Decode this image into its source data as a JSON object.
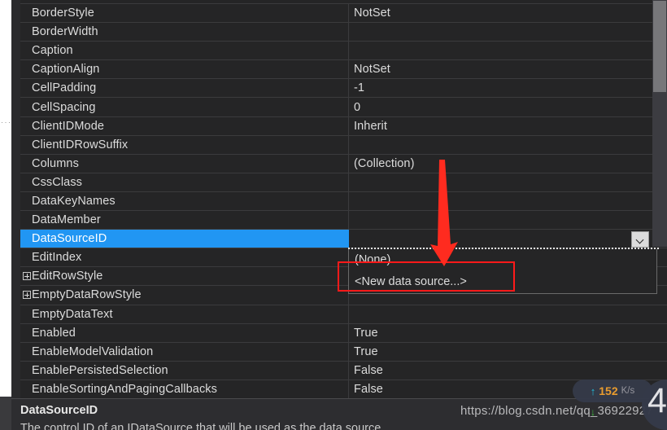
{
  "grid": {
    "rows": [
      {
        "name": "BorderStyle",
        "value": "NotSet",
        "expandable": false,
        "selected": false
      },
      {
        "name": "BorderWidth",
        "value": "",
        "expandable": false,
        "selected": false
      },
      {
        "name": "Caption",
        "value": "",
        "expandable": false,
        "selected": false
      },
      {
        "name": "CaptionAlign",
        "value": "NotSet",
        "expandable": false,
        "selected": false
      },
      {
        "name": "CellPadding",
        "value": "-1",
        "expandable": false,
        "selected": false
      },
      {
        "name": "CellSpacing",
        "value": "0",
        "expandable": false,
        "selected": false
      },
      {
        "name": "ClientIDMode",
        "value": "Inherit",
        "expandable": false,
        "selected": false
      },
      {
        "name": "ClientIDRowSuffix",
        "value": "",
        "expandable": false,
        "selected": false
      },
      {
        "name": "Columns",
        "value": "(Collection)",
        "expandable": false,
        "selected": false
      },
      {
        "name": "CssClass",
        "value": "",
        "expandable": false,
        "selected": false
      },
      {
        "name": "DataKeyNames",
        "value": "",
        "expandable": false,
        "selected": false
      },
      {
        "name": "DataMember",
        "value": "",
        "expandable": false,
        "selected": false
      },
      {
        "name": "DataSourceID",
        "value": "",
        "expandable": false,
        "selected": true
      },
      {
        "name": "EditIndex",
        "value": "(None)",
        "expandable": false,
        "selected": false
      },
      {
        "name": "EditRowStyle",
        "value": "",
        "expandable": true,
        "selected": false
      },
      {
        "name": "EmptyDataRowStyle",
        "value": "",
        "expandable": true,
        "selected": false
      },
      {
        "name": "EmptyDataText",
        "value": "",
        "expandable": false,
        "selected": false
      },
      {
        "name": "Enabled",
        "value": "True",
        "expandable": false,
        "selected": false
      },
      {
        "name": "EnableModelValidation",
        "value": "True",
        "expandable": false,
        "selected": false
      },
      {
        "name": "EnablePersistedSelection",
        "value": "False",
        "expandable": false,
        "selected": false
      },
      {
        "name": "EnableSortingAndPagingCallbacks",
        "value": "False",
        "expandable": false,
        "selected": false
      }
    ]
  },
  "dropdown": {
    "items": [
      {
        "label": "(None)"
      },
      {
        "label": "<New data source...>"
      }
    ],
    "button_icon": "chevron-down-icon"
  },
  "description": {
    "title": "DataSourceID",
    "body": "The control ID of an IDataSource that will be used as the data source."
  },
  "watermark": {
    "text": "https://blog.csdn.net/qq_36922927"
  },
  "net_widget": {
    "up_arrow": "↑",
    "value": "152",
    "unit": "K/s",
    "down_arrow": "↓",
    "badge_digit": "4"
  },
  "colors": {
    "selection": "#2196f3",
    "annotation": "#ff1a1a",
    "background": "#252526",
    "net_value": "#f0a030",
    "net_up": "#22c3e0"
  },
  "left_gutter": {
    "ellipsis": "···"
  }
}
